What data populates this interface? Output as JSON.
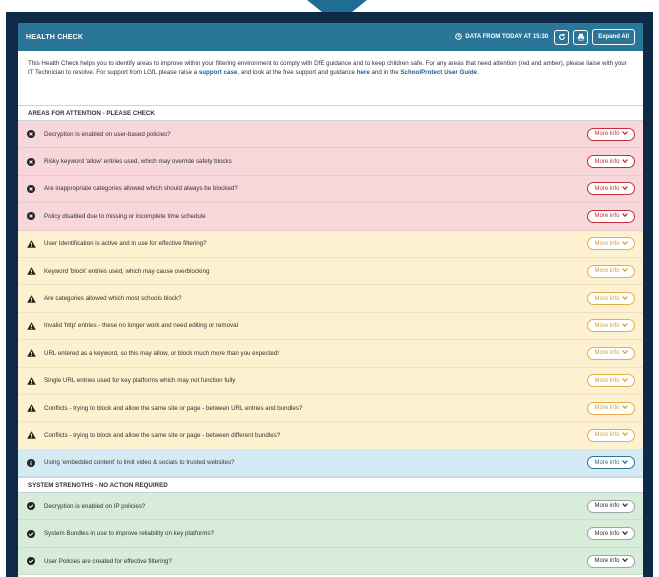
{
  "header": {
    "title": "HEALTH CHECK",
    "data_stamp": "DATA FROM TODAY AT 15:30",
    "expand_label": "Expand All"
  },
  "intro": {
    "text_before_support": "This Health Check helps you to identify areas to improve within your filtering environment to comply with DfE guidance and to keep children safe. For any areas that need attention (red and amber), please liaise with your IT Technician to resolve. For support from LGfL please raise a ",
    "support_link": "support case",
    "text_middle": ", and look at the free support and guidance ",
    "here_link": "here",
    "text_and": " and in the ",
    "guide_link": "SchoolProtect User Guide",
    "text_end": "."
  },
  "attention": {
    "heading": "AREAS FOR ATTENTION - PLEASE CHECK",
    "items": [
      {
        "level": "red",
        "text": "Decryption is enabled on user-based policies?"
      },
      {
        "level": "red",
        "text": "Risky keyword 'allow' entries used, which may override safety blocks"
      },
      {
        "level": "red",
        "text": "Are inappropriate categories allowed which should always be blocked?"
      },
      {
        "level": "red",
        "text": "Policy disabled due to missing or incomplete time schedule"
      },
      {
        "level": "amber",
        "text": "User Identification is active and in use for effective filtering?"
      },
      {
        "level": "amber",
        "text": "Keyword 'block' entries used, which may cause overblocking"
      },
      {
        "level": "amber",
        "text": "Are categories allowed which most schools block?"
      },
      {
        "level": "amber",
        "text": "Invalid 'http' entries - these no longer work and need editing or removal"
      },
      {
        "level": "amber",
        "text": "URL entered as a keyword, so this may allow, or block much more than you expected!"
      },
      {
        "level": "amber",
        "text": "Single URL entries used for key platforms which may not function fully"
      },
      {
        "level": "amber",
        "text": "Conflicts - trying to block and allow the same site or page - between URL entries and bundles?"
      },
      {
        "level": "amber",
        "text": "Conflicts - trying to block and allow the same site or page - between different bundles?"
      },
      {
        "level": "blue",
        "text": "Using 'embedded content' to limit video & socials to trusted websites?"
      }
    ]
  },
  "strengths": {
    "heading": "SYSTEM STRENGTHS - NO ACTION REQUIRED",
    "items": [
      {
        "level": "green",
        "text": "Decryption is enabled on IP policies?"
      },
      {
        "level": "green",
        "text": "System Bundles in use to improve reliability on key platforms?"
      },
      {
        "level": "green",
        "text": "User Policies are created for effective filtering?"
      }
    ]
  },
  "more_info_label": "More info",
  "colors": {
    "header": "#2a7699",
    "frame": "#0e2a47",
    "red": "#c4303b",
    "amber": "#e3ae52",
    "info": "#2a7699",
    "ok": "#333333"
  },
  "icons": {
    "red": "x-circle-icon",
    "amber": "warning-triangle-icon",
    "blue": "info-circle-icon",
    "green": "check-circle-icon",
    "refresh": "refresh-icon",
    "print": "print-icon",
    "clock": "clock-icon",
    "chevron": "chevron-down-icon"
  }
}
